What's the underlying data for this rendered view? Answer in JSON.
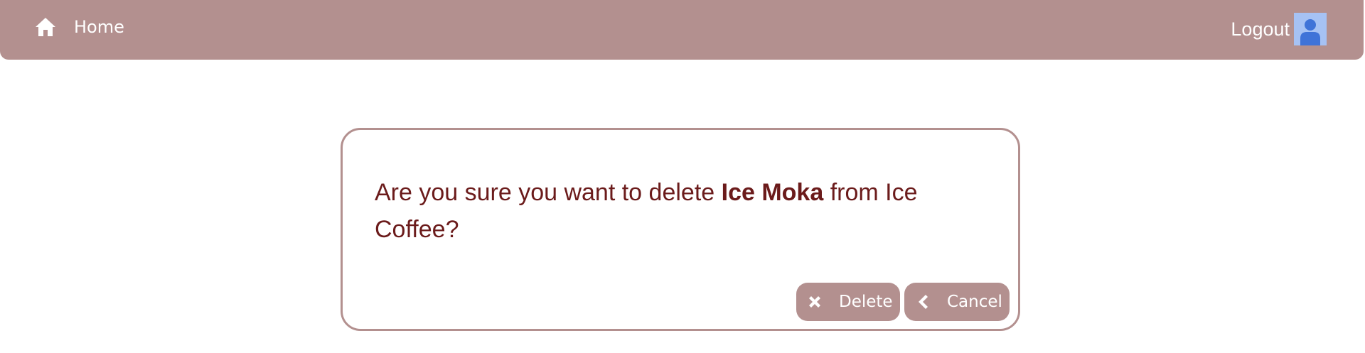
{
  "nav": {
    "home_label": "Home",
    "logout_label": "Logout",
    "icons": {
      "home": "home-icon",
      "avatar": "user-avatar-icon"
    }
  },
  "dialog": {
    "prefix": "Are you sure you want to delete ",
    "item_name": "Ice Moka",
    "middle": " from ",
    "category_name": "Ice Coffee",
    "suffix": "?",
    "delete_label": "Delete",
    "cancel_label": "Cancel",
    "icons": {
      "delete": "close-icon",
      "cancel": "chevron-left-icon"
    }
  },
  "colors": {
    "navbar": "#b3908f",
    "text": "#6b1b1b",
    "avatar_bg": "#a6c2f4",
    "avatar_fg": "#3f73d8",
    "button": "#b3908f"
  }
}
